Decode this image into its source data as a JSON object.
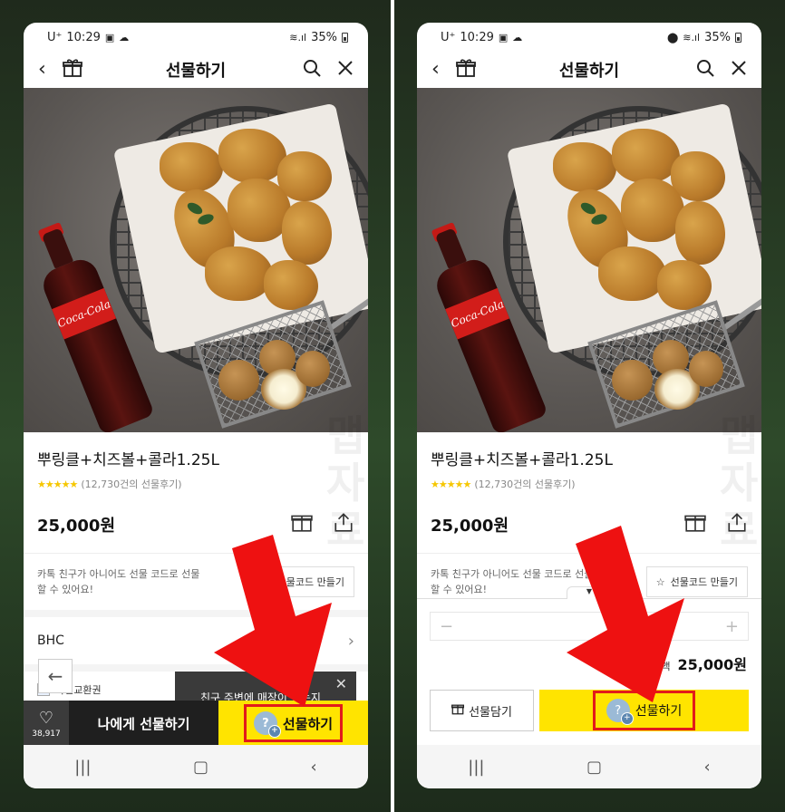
{
  "status": {
    "carrier": "U⁺",
    "time": "10:29",
    "battery": "35%"
  },
  "nav": {
    "title": "선물하기",
    "back_icon": "back-arrow-icon",
    "gift_icon": "gift-box-icon",
    "search_icon": "search-icon",
    "close_icon": "close-icon"
  },
  "product": {
    "name": "뿌링클+치즈볼+콜라1.25L",
    "stars": "★★★★★",
    "review_count": "(12,730건의 선물후기)",
    "price": "25,000원",
    "bottle_label": "Coca-Cola"
  },
  "gift_code": {
    "text": "카톡 친구가 아니어도 선물 코드로 선물 할 수 있어요!",
    "left_button": "물코드 만들기",
    "right_button": "선물코드 만들기"
  },
  "brand": {
    "name": "BHC"
  },
  "mobile_ticket": {
    "label": "모바일교환권",
    "visible_label": "바일교환권"
  },
  "toast": {
    "text": "친구 주변에 매장이 있는지"
  },
  "bottom_bar": {
    "like_count": "38,917",
    "self_gift": "나에게 선물하기",
    "gift": "선물하기"
  },
  "sheet": {
    "qty_minus": "−",
    "qty_plus": "+",
    "total_label": "총금액",
    "total_value": "25,000원",
    "basket_button": "선물담기",
    "gift_button": "선물하기"
  },
  "watermark": "맵자료"
}
